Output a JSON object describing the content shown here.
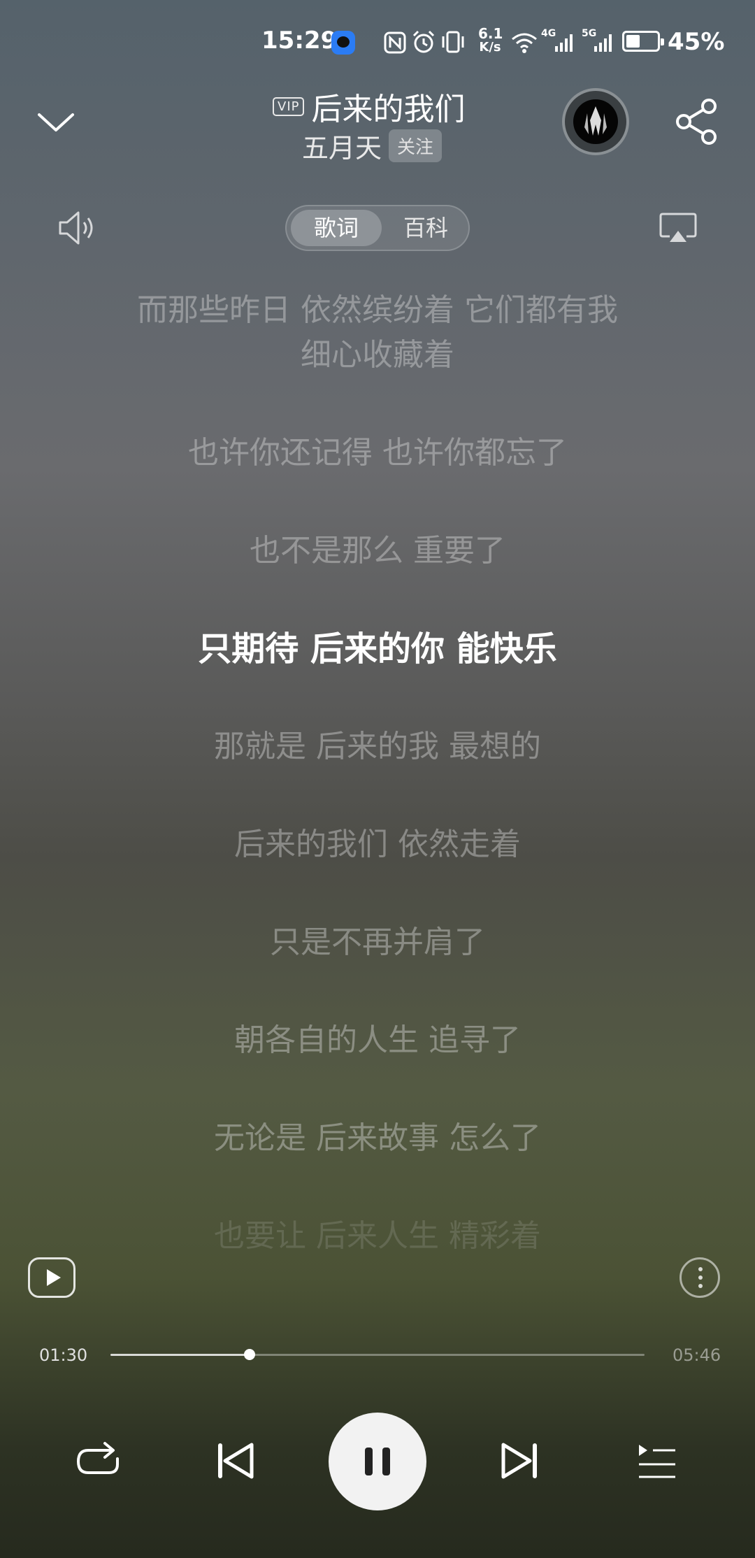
{
  "status_bar": {
    "time": "15:29",
    "net_speed_value": "6.1",
    "net_speed_unit": "K/s",
    "signal_1_label": "4G",
    "signal_2_label": "5G",
    "battery_pct": "45%",
    "battery_level": 0.45
  },
  "header": {
    "vip_badge": "VIP",
    "title": "后来的我们",
    "artist": "五月天",
    "follow_label": "关注"
  },
  "tabs": {
    "lyrics": "歌词",
    "wiki": "百科"
  },
  "lyrics": [
    "而那些昨日 依然缤纷着 它们都有我",
    "细心收藏着",
    "也许你还记得 也许你都忘了",
    "也不是那么 重要了",
    "只期待 后来的你 能快乐",
    "那就是 后来的我 最想的",
    "后来的我们 依然走着",
    "只是不再并肩了",
    "朝各自的人生 追寻了",
    "无论是 后来故事 怎么了",
    "也要让 后来人生 精彩着"
  ],
  "active_lyric_index": 4,
  "player": {
    "current_time": "01:30",
    "total_time": "05:46",
    "progress": 0.26
  },
  "icons": {
    "collapse": "chevron-down-icon",
    "share": "share-icon",
    "volume": "volume-icon",
    "cast": "cast-icon",
    "video": "play-video-icon",
    "more": "more-icon",
    "repeat": "repeat-icon",
    "prev": "previous-icon",
    "pause": "pause-icon",
    "next": "next-icon",
    "playlist": "playlist-icon"
  }
}
